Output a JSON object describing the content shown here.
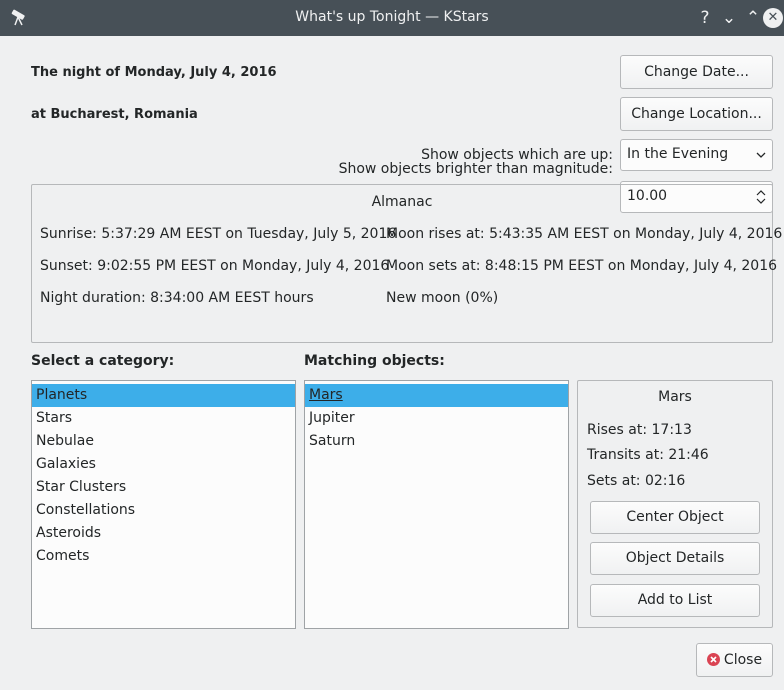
{
  "window": {
    "title": "What's up Tonight — KStars",
    "help_glyph": "?",
    "minimize_glyph": "⌄",
    "maximize_glyph": "⌃",
    "close_glyph": "✕"
  },
  "header": {
    "date_text": "The night of Monday, July 4, 2016",
    "location_text": "at Bucharest, Romania",
    "change_date_label": "Change Date...",
    "change_location_label": "Change Location..."
  },
  "filters": {
    "show_up_label": "Show objects which are up:",
    "show_up_value": "In the Evening",
    "magnitude_label": "Show objects brighter than magnitude:",
    "magnitude_value": "10.00"
  },
  "almanac": {
    "title": "Almanac",
    "sunrise": "Sunrise: 5:37:29 AM EEST on Tuesday, July 5, 2016",
    "sunset": "Sunset: 9:02:55 PM EEST on Monday, July 4, 2016",
    "night_duration": "Night duration: 8:34:00 AM EEST hours",
    "moonrise": "Moon rises at: 5:43:35 AM EEST on Monday, July 4, 2016",
    "moonset": "Moon sets at: 8:48:15 PM EEST on Monday, July 4, 2016",
    "moon_phase": "New moon (0%)"
  },
  "categories": {
    "heading": "Select a category:",
    "items": [
      "Planets",
      "Stars",
      "Nebulae",
      "Galaxies",
      "Star Clusters",
      "Constellations",
      "Asteroids",
      "Comets"
    ],
    "selected_index": 0
  },
  "matches": {
    "heading": "Matching objects:",
    "items": [
      "Mars",
      "Jupiter",
      "Saturn"
    ],
    "selected_index": 0
  },
  "object_info": {
    "name": "Mars",
    "rises": "Rises at: 17:13",
    "transits": "Transits at: 21:46",
    "sets": "Sets at: 02:16",
    "center_label": "Center Object",
    "details_label": "Object Details",
    "add_label": "Add to List"
  },
  "footer": {
    "close_label": "Close"
  },
  "colors": {
    "titlebar": "#475057",
    "selection": "#3daee9",
    "close_icon": "#da4453"
  }
}
